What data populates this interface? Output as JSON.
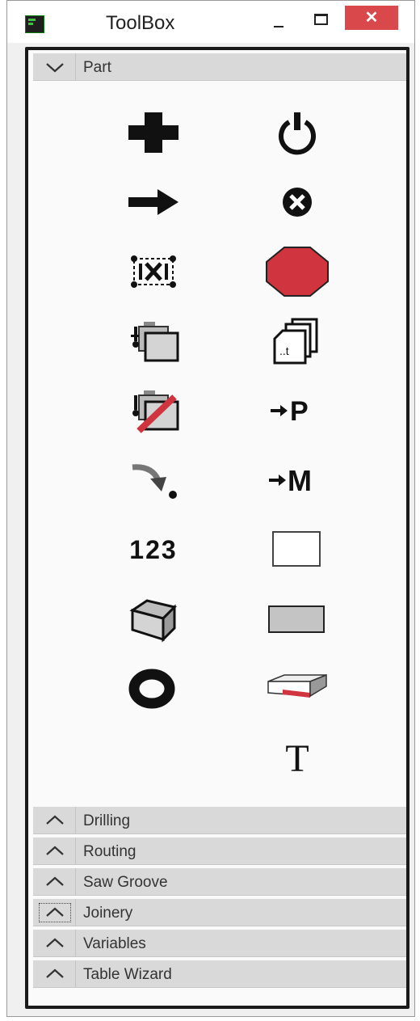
{
  "window": {
    "title": "ToolBox",
    "close_glyph": "✕"
  },
  "sections": {
    "part": {
      "label": "Part",
      "expanded": true
    },
    "drilling": {
      "label": "Drilling"
    },
    "routing": {
      "label": "Routing"
    },
    "saw_groove": {
      "label": "Saw Groove"
    },
    "joinery": {
      "label": "Joinery"
    },
    "variables": {
      "label": "Variables"
    },
    "table_wizard": {
      "label": "Table Wizard"
    }
  },
  "tools": {
    "set_p": "→P",
    "set_m": "→M",
    "numbering": "123",
    "text": "T",
    "local": "..t"
  },
  "colors": {
    "stop_red": "#d0343f",
    "close_red": "#d9484a",
    "header_gray": "#d9d9d9"
  }
}
